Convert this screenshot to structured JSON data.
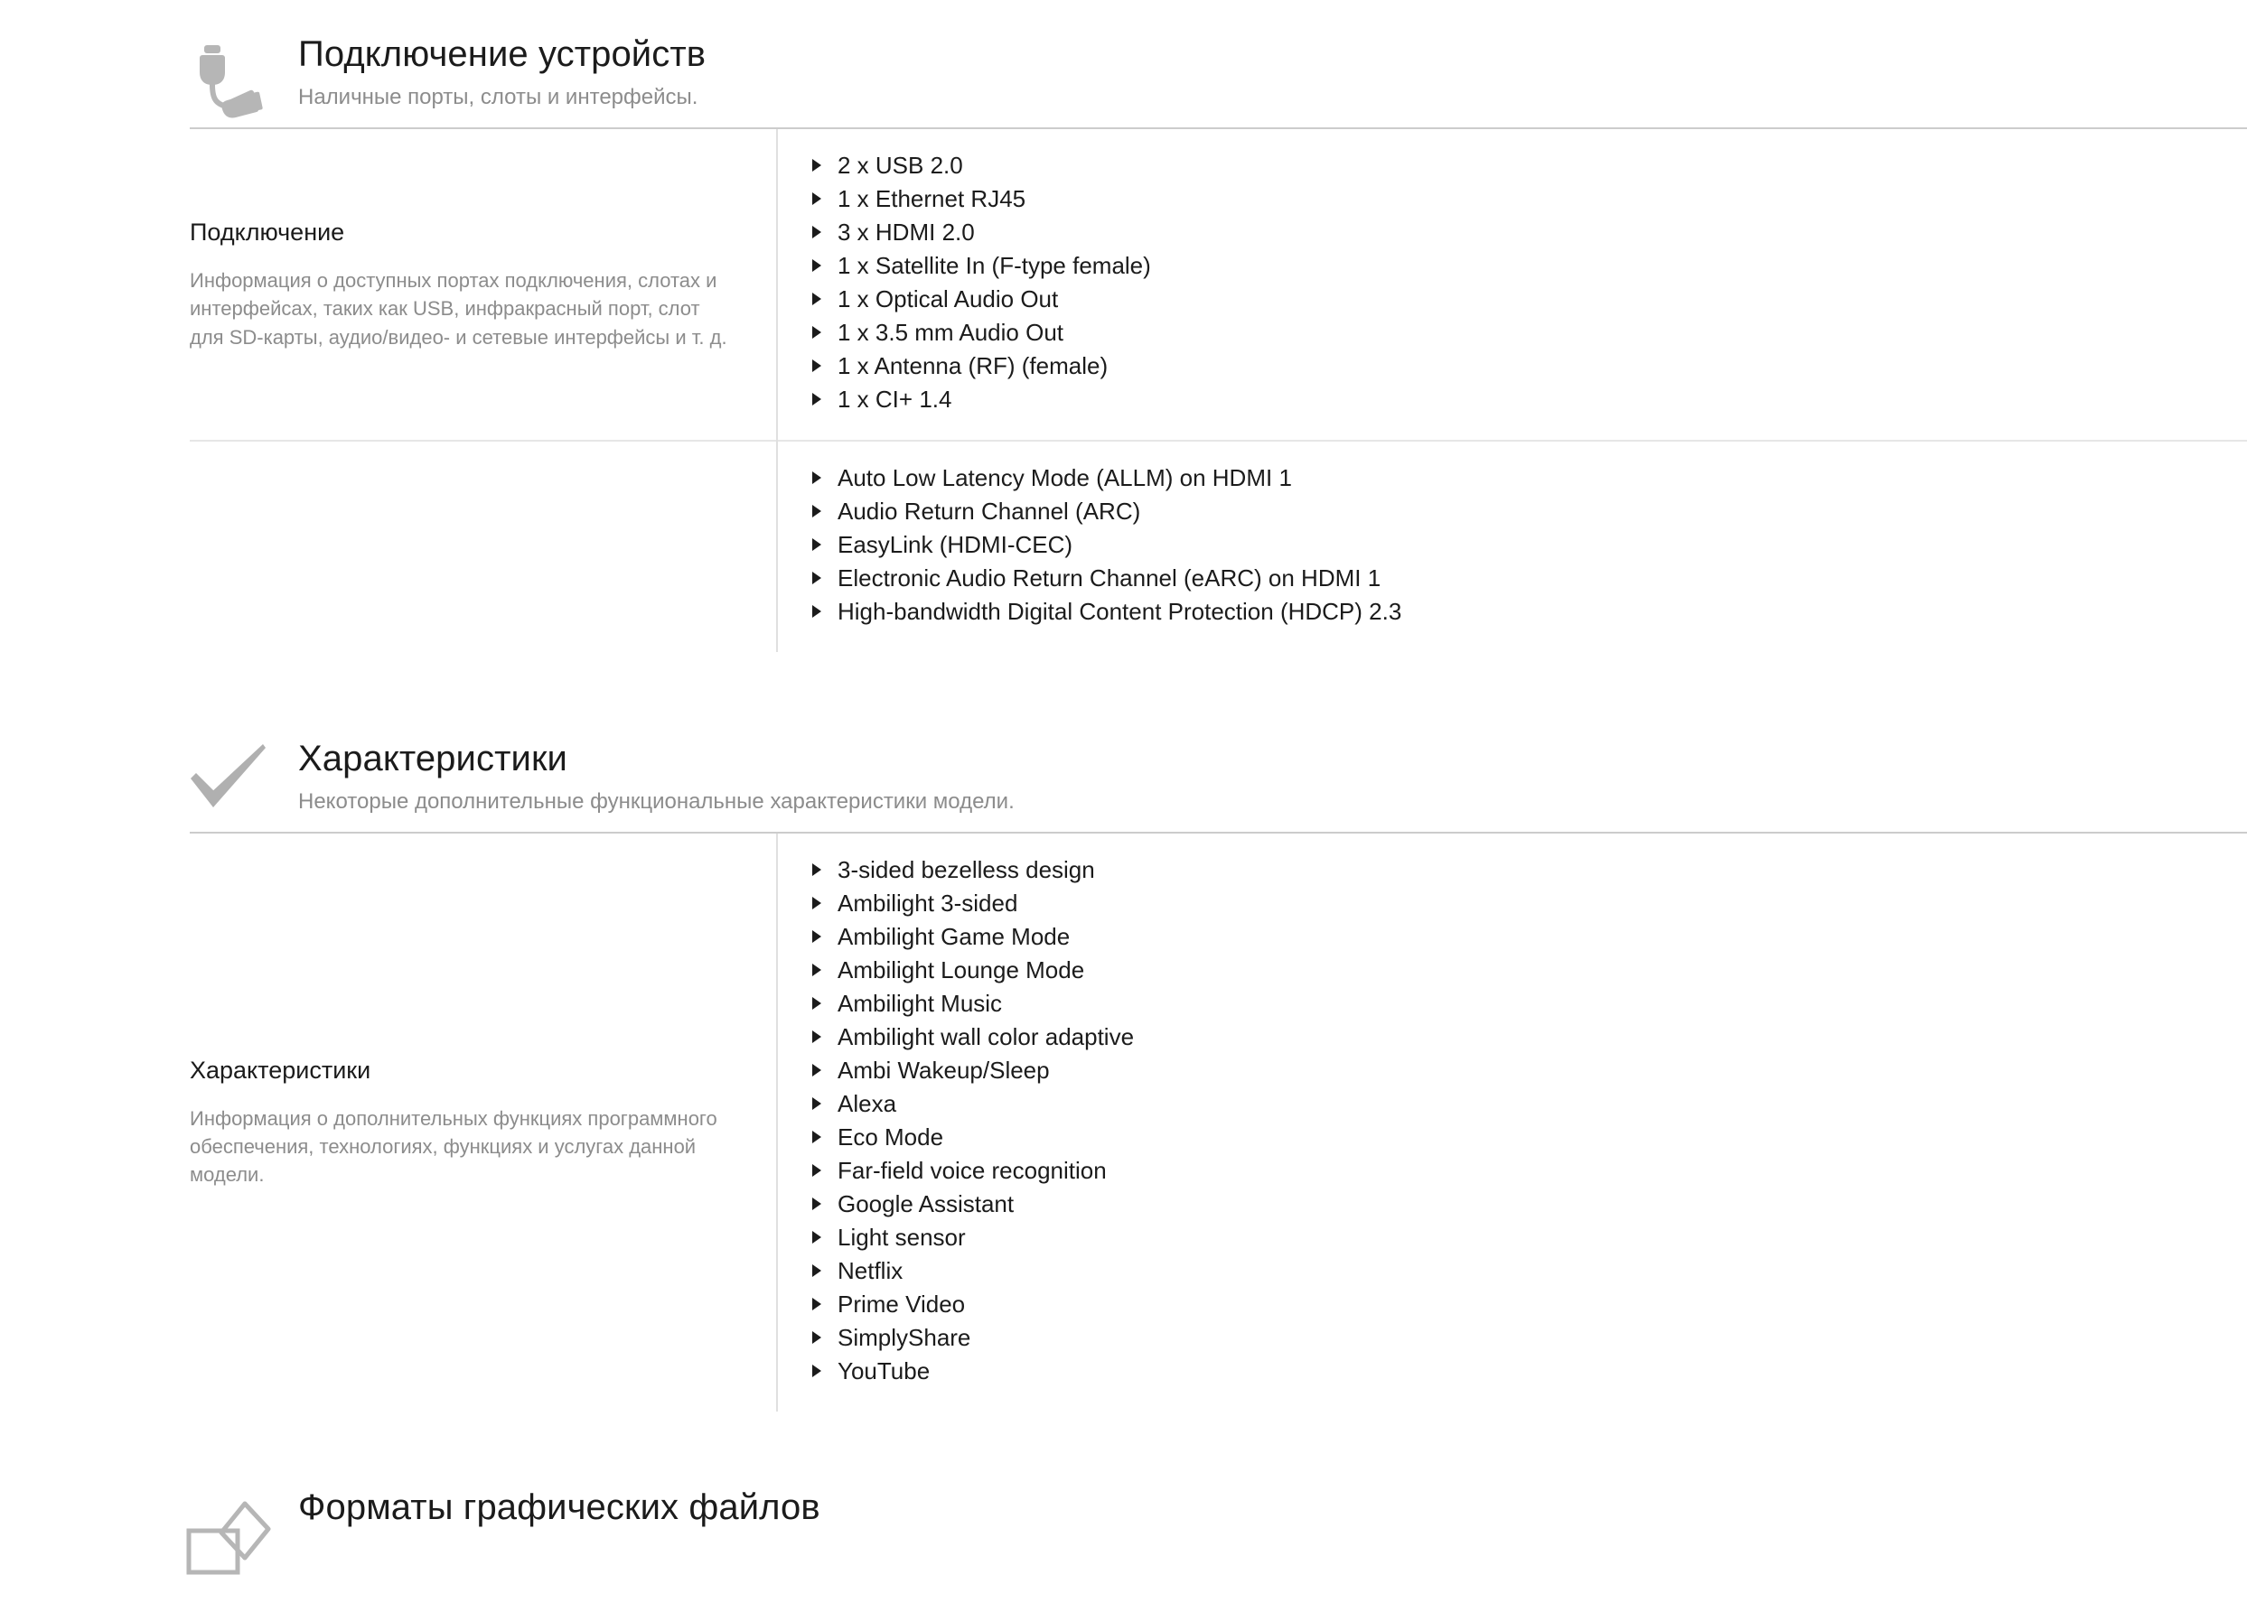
{
  "sections": [
    {
      "id": "connectivity",
      "icon": "cable-plug-icon",
      "title": "Подключение устройств",
      "subtitle": "Наличные порты, слоты и интерфейсы.",
      "rows": [
        {
          "label": "Подключение",
          "description": "Информация о доступных портах подключения, слотах и интерфейсах, таких как USB, инфракрасный порт, слот для SD-карты, аудио/видео- и сетевые интерфейсы и т. д.",
          "values": [
            "2 x USB 2.0",
            "1 x Ethernet RJ45",
            "3 x HDMI 2.0",
            "1 x Satellite In (F-type female)",
            "1 x Optical Audio Out",
            "1 x 3.5 mm Audio Out",
            "1 x Antenna (RF) (female)",
            "1 x CI+ 1.4"
          ]
        },
        {
          "label": "",
          "description": "",
          "values": [
            "Auto Low Latency Mode (ALLM) on HDMI 1",
            "Audio Return Channel (ARC)",
            "EasyLink (HDMI-CEC)",
            "Electronic Audio Return Channel (eARC) on HDMI 1",
            "High-bandwidth Digital Content Protection (HDCP) 2.3"
          ]
        }
      ]
    },
    {
      "id": "features",
      "icon": "checkmark-icon",
      "title": "Характеристики",
      "subtitle": "Некоторые дополнительные функциональные характеристики модели.",
      "rows": [
        {
          "label": "Характеристики",
          "description": "Информация о дополнительных функциях программного обеспечения, технологиях, функциях и услугах данной модели.",
          "values": [
            "3-sided bezelless design",
            "Ambilight 3-sided",
            "Ambilight Game Mode",
            "Ambilight Lounge Mode",
            "Ambilight Music",
            "Ambilight wall color adaptive",
            "Ambi Wakeup/Sleep",
            "Alexa",
            "Eco Mode",
            "Far-field voice recognition",
            "Google Assistant",
            "Light sensor",
            "Netflix",
            "Prime Video",
            "SimplyShare",
            "YouTube"
          ]
        }
      ]
    },
    {
      "id": "graphics-formats",
      "icon": "image-formats-icon",
      "title": "Форматы графических файлов",
      "subtitle": "",
      "rows": []
    }
  ],
  "colors": {
    "text": "#1b1b1b",
    "muted": "#8c8c8c",
    "icon_gray": "#b3b3b3",
    "rule": "#cccccc",
    "rule_light": "#e0e0e0",
    "background": "#ffffff"
  }
}
